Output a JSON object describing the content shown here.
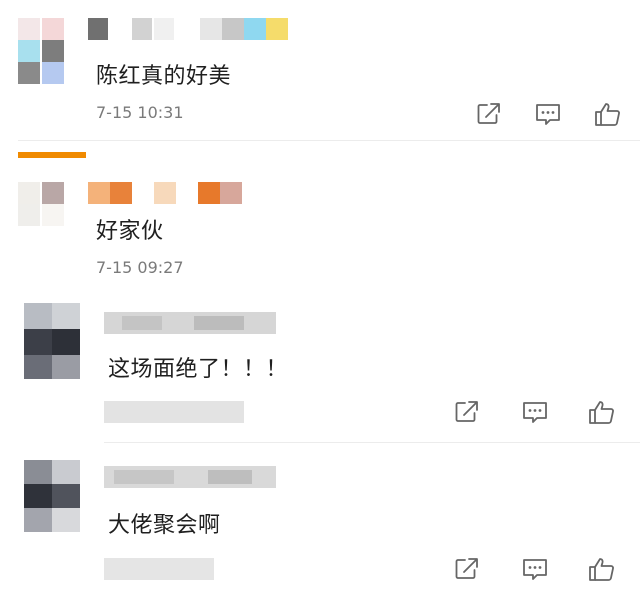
{
  "comments": [
    {
      "text": "陈红真的好美",
      "time": "7-15 10:31"
    },
    {
      "text": "好家伙",
      "time": "7-15 09:27"
    },
    {
      "text": "这场面绝了！！！",
      "time": ""
    },
    {
      "text": "大佬聚会啊",
      "time": ""
    }
  ],
  "actions": {
    "share": "share-icon",
    "reply": "comment-icon",
    "like": "like-icon"
  },
  "colors": {
    "accent_bar": "#f08a00",
    "text": "#1f1f1f",
    "timestamp": "#7a7a7a",
    "icon": "#666666"
  }
}
